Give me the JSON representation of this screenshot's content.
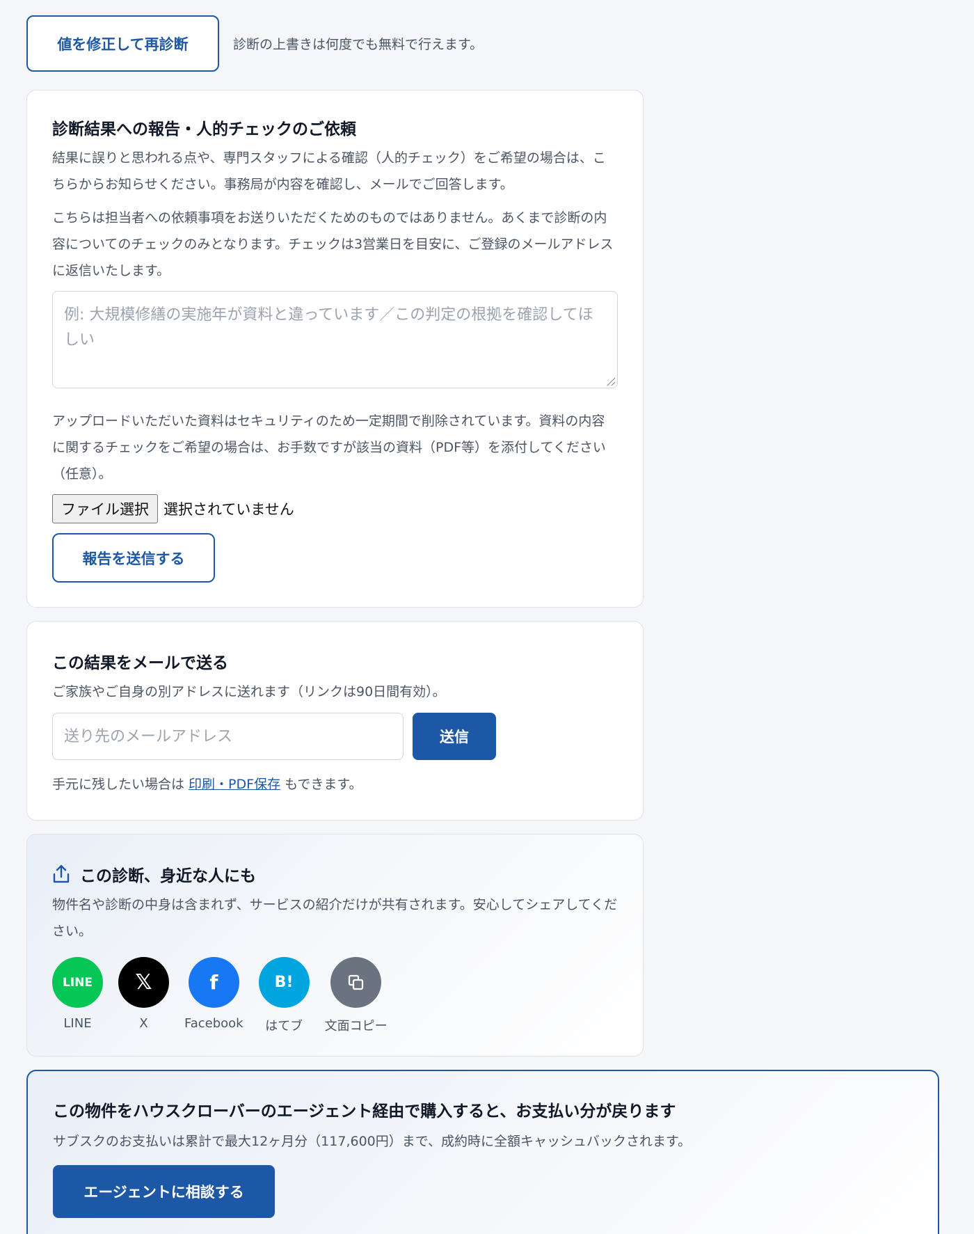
{
  "top": {
    "recheck_button": "値を修正して再診断",
    "note": "診断の上書きは何度でも無料で行えます。"
  },
  "report": {
    "title": "診断結果への報告・人的チェックのご依頼",
    "para1": "結果に誤りと思われる点や、専門スタッフによる確認（人的チェック）をご希望の場合は、こちらからお知らせください。事務局が内容を確認し、メールでご回答します。",
    "para2": "こちらは担当者への依頼事項をお送りいただくためのものではありません。あくまで診断の内容についてのチェックのみとなります。チェックは3営業日を目安に、ご登録のメールアドレスに返信いたします。",
    "textarea_placeholder": "例: 大規模修繕の実施年が資料と違っています／この判定の根拠を確認してほしい",
    "para3": "アップロードいただいた資料はセキュリティのため一定期間で削除されています。資料の内容に関するチェックをご希望の場合は、お手数ですが該当の資料（PDF等）を添付してください（任意）。",
    "file_button": "ファイル選択",
    "file_status": "選択されていません",
    "submit_button": "報告を送信する"
  },
  "email": {
    "title": "この結果をメールで送る",
    "desc": "ご家族やご自身の別アドレスに送れます（リンクは90日間有効）。",
    "input_placeholder": "送り先のメールアドレス",
    "send_button": "送信",
    "print_prefix": "手元に残したい場合は ",
    "print_link": "印刷・PDF保存",
    "print_suffix": " もできます。"
  },
  "share": {
    "title": "この診断、身近な人にも",
    "desc": "物件名や診断の中身は含まれず、サービスの紹介だけが共有されます。安心してシェアしてください。",
    "items": [
      {
        "label": "LINE",
        "icon_text": "LINE",
        "icon": "line-icon",
        "color": "#06c755"
      },
      {
        "label": "X",
        "icon_text": "𝕏",
        "icon": "x-icon",
        "color": "#000000"
      },
      {
        "label": "Facebook",
        "icon_text": "f",
        "icon": "facebook-icon",
        "color": "#1877f2"
      },
      {
        "label": "はてブ",
        "icon_text": "B!",
        "icon": "hatena-bookmark-icon",
        "color": "#00a4de"
      },
      {
        "label": "文面コピー",
        "icon_text": "",
        "icon": "copy-icon",
        "color": "#6b7280"
      }
    ]
  },
  "agent": {
    "title": "この物件をハウスクローバーのエージェント経由で購入すると、お支払い分が戻ります",
    "desc": "サブスクのお支払いは累計で最大12ヶ月分（117,600円）まで、成約時に全額キャッシュバックされます。",
    "button": "エージェントに相談する"
  },
  "colors": {
    "accent": "#1d58a7",
    "background": "#f4f6f9"
  }
}
